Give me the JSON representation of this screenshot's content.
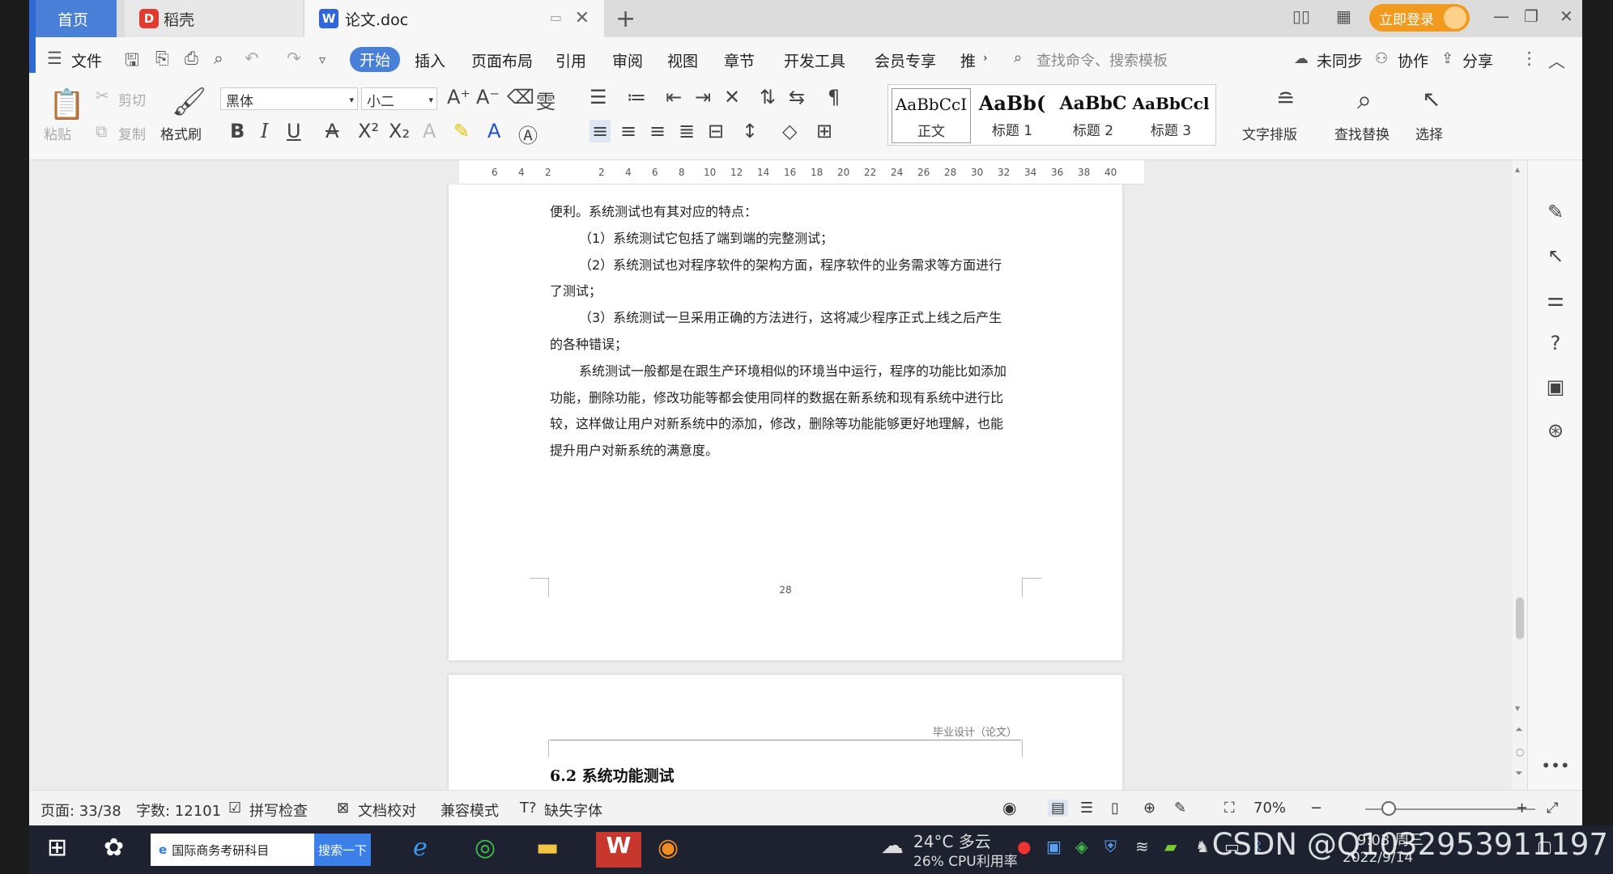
{
  "tabs": {
    "home": "首页",
    "daoke": "稻壳",
    "doc": "论文.doc",
    "login": "立即登录"
  },
  "menu": {
    "file": "文件",
    "start": "开始",
    "insert": "插入",
    "layout": "页面布局",
    "reference": "引用",
    "review": "审阅",
    "view": "视图",
    "chapter": "章节",
    "devtools": "开发工具",
    "member": "会员专享",
    "recommend": "推",
    "search_placeholder": "查找命令、搜索模板",
    "unsync": "未同步",
    "collab": "协作",
    "share": "分享"
  },
  "ribbon": {
    "paste": "粘贴",
    "cut": "剪切",
    "copy": "复制",
    "format_painter": "格式刷",
    "font": "黑体",
    "size": "小二",
    "styles": [
      {
        "preview": "AaBbCcI",
        "name": "正文"
      },
      {
        "preview": "AaBb(",
        "name": "标题 1"
      },
      {
        "preview": "AaBbC",
        "name": "标题 2"
      },
      {
        "preview": "AaBbCcl",
        "name": "标题 3"
      }
    ],
    "text_layout": "文字排版",
    "find_replace": "查找替换",
    "select": "选择"
  },
  "ruler": [
    "6",
    "4",
    "2",
    "",
    "2",
    "4",
    "6",
    "8",
    "10",
    "12",
    "14",
    "16",
    "18",
    "20",
    "22",
    "24",
    "26",
    "28",
    "30",
    "32",
    "34",
    "36",
    "38",
    "40"
  ],
  "document": {
    "page1_lines": [
      {
        "text": "便利。系统测试也有其对应的特点：",
        "indent": false
      },
      {
        "text": "（1）系统测试它包括了端到端的完整测试；",
        "indent": true
      },
      {
        "text": "（2）系统测试也对程序软件的架构方面，程序软件的业务需求等方面进行",
        "indent": true
      },
      {
        "text": "了测试；",
        "indent": false
      },
      {
        "text": "（3）系统测试一旦采用正确的方法进行，这将减少程序正式上线之后产生",
        "indent": true
      },
      {
        "text": "的各种错误；",
        "indent": false
      },
      {
        "text": "系统测试一般都是在跟生产环境相似的环境当中运行，程序的功能比如添加",
        "indent": true
      },
      {
        "text": "功能，删除功能，修改功能等都会使用同样的数据在新系统和现有系统中进行比",
        "indent": false
      },
      {
        "text": "较，这样做让用户对新系统中的添加，修改，删除等功能能够更好地理解，也能",
        "indent": false
      },
      {
        "text": "提升用户对新系统的满意度。",
        "indent": false
      }
    ],
    "page_number": "28",
    "page2_header": "毕业设计（论文）",
    "section_title": "6.2  系统功能测试"
  },
  "status": {
    "page": "页面: 33/38",
    "words": "字数: 12101",
    "spell": "拼写检查",
    "proof": "文档校对",
    "compat": "兼容模式",
    "missing_font": "缺失字体",
    "zoom": "70%"
  },
  "taskbar": {
    "search_text": "国际商务考研科目",
    "search_btn": "搜索一下",
    "weather": "24°C 多云",
    "cpu": "26% CPU利用率",
    "time": "9:03 周三",
    "date": "2022/9/14",
    "watermark": "CSDN @Q1032953911197"
  },
  "colors": {
    "accent": "#4a7fd8",
    "login": "#f29a1e"
  }
}
